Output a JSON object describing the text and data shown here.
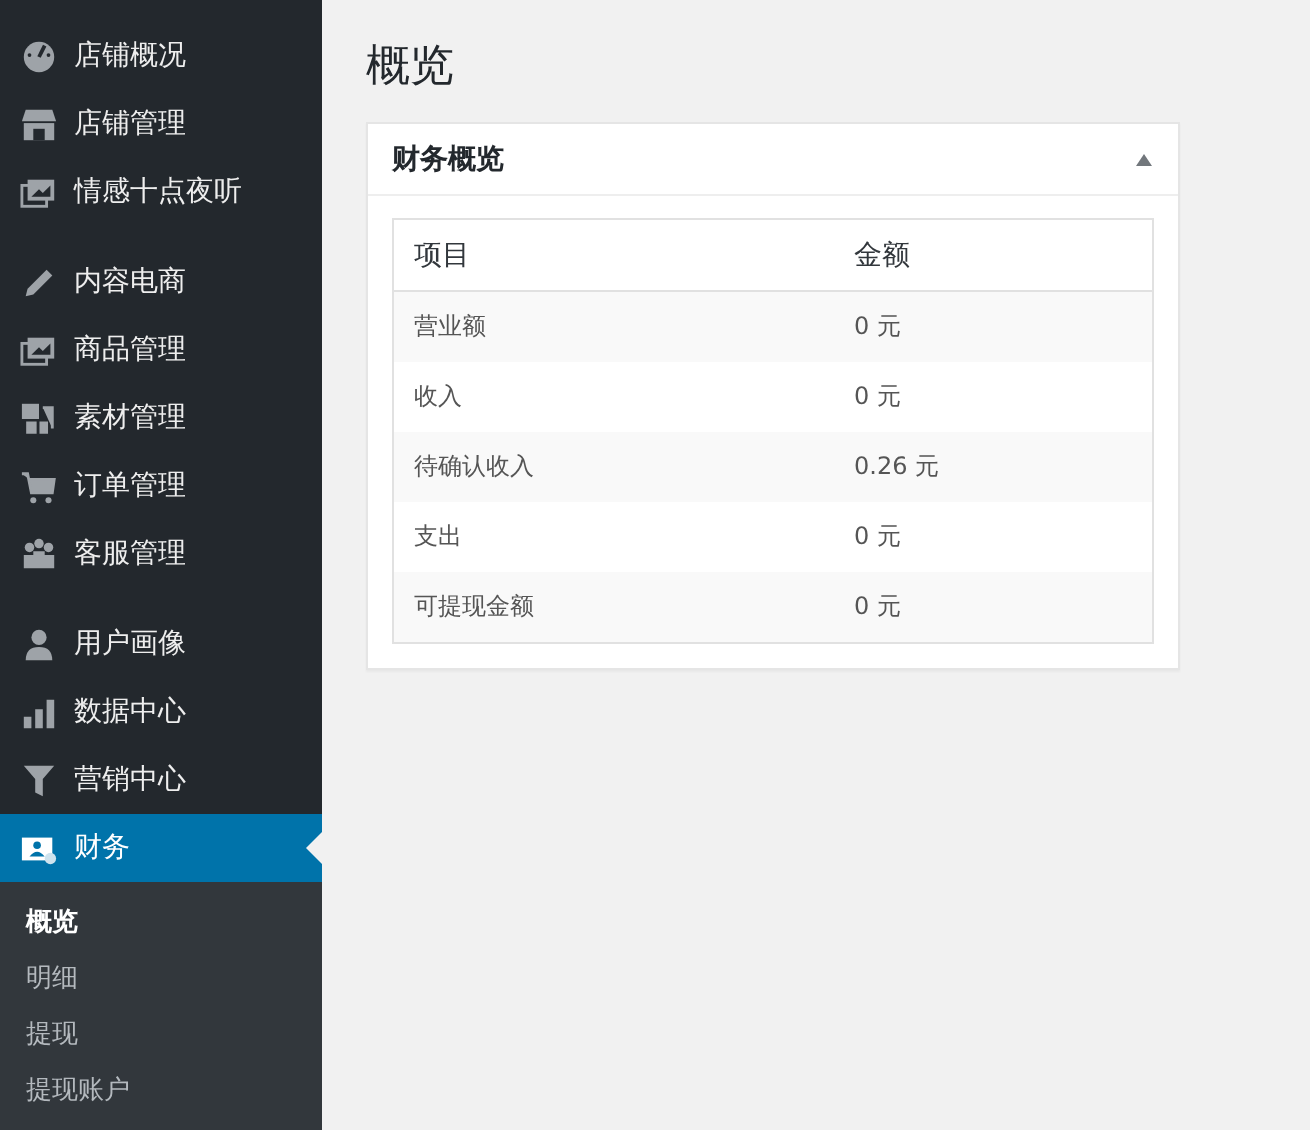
{
  "sidebar": {
    "groups": [
      [
        {
          "label": "店铺概况",
          "selected": false
        },
        {
          "label": "店铺管理",
          "selected": false
        },
        {
          "label": "情感十点夜听",
          "selected": false
        }
      ],
      [
        {
          "label": "内容电商",
          "selected": false
        },
        {
          "label": "商品管理",
          "selected": false
        },
        {
          "label": "素材管理",
          "selected": false
        },
        {
          "label": "订单管理",
          "selected": false
        },
        {
          "label": "客服管理",
          "selected": false
        }
      ],
      [
        {
          "label": "用户画像",
          "selected": false
        },
        {
          "label": "数据中心",
          "selected": false
        },
        {
          "label": "营销中心",
          "selected": false
        },
        {
          "label": "财务",
          "selected": true,
          "children": [
            {
              "label": "概览",
              "selected": true
            },
            {
              "label": "明细",
              "selected": false
            },
            {
              "label": "提现",
              "selected": false
            },
            {
              "label": "提现账户",
              "selected": false
            }
          ]
        }
      ]
    ]
  },
  "page": {
    "title": "概览"
  },
  "card": {
    "title": "财务概览",
    "expanded": true,
    "table": {
      "columns": [
        "项目",
        "金额"
      ],
      "rows": [
        [
          "营业额",
          "0 元"
        ],
        [
          "收入",
          "0 元"
        ],
        [
          "待确认收入",
          "0.26 元"
        ],
        [
          "支出",
          "0 元"
        ],
        [
          "可提现金额",
          "0 元"
        ]
      ]
    }
  }
}
